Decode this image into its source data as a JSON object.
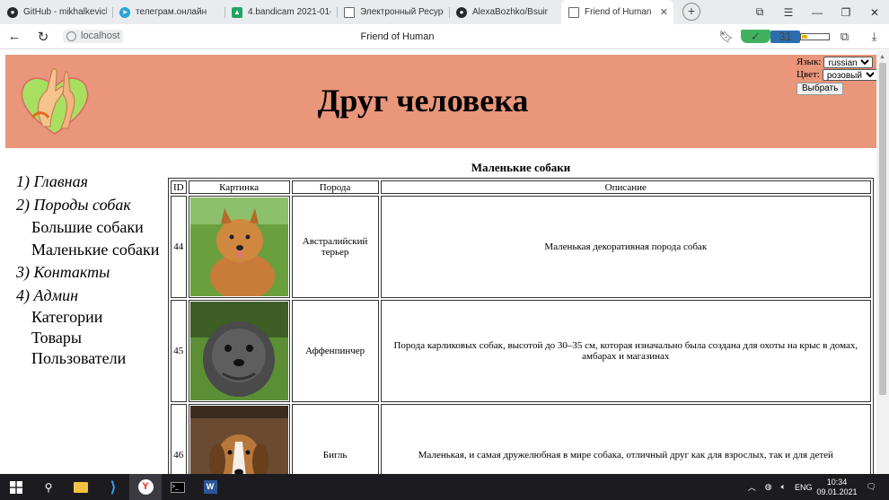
{
  "browser": {
    "tabs": [
      {
        "title": "GitHub - mikhalkevich",
        "icon": "github-icon",
        "color": "#24292e"
      },
      {
        "title": "телеграм.онлайн",
        "icon": "telegram-icon",
        "color": "#2aa3d8"
      },
      {
        "title": "4.bandicam 2021-01-0",
        "icon": "google-drive-icon",
        "color": "#1fa463"
      },
      {
        "title": "Электронный Ресурс",
        "icon": "document-icon",
        "color": "#666666"
      },
      {
        "title": "AlexaBozhko/Bsuir",
        "icon": "github-icon",
        "color": "#24292e"
      },
      {
        "title": "Friend of Human",
        "icon": "document-icon",
        "color": "#666666",
        "active": true
      }
    ],
    "url": "localhost",
    "page_title": "Friend of Human"
  },
  "site": {
    "title": "Друг человека",
    "header_color": "#e9967a",
    "settings": {
      "lang_label": "Язык:",
      "lang_value": "russian",
      "color_label": "Цвет:",
      "color_value": "розовый",
      "submit_label": "Выбрать"
    }
  },
  "nav": {
    "home": "1) Главная",
    "breeds": "2) Породы собак",
    "big_dogs": "Большие собаки",
    "small_dogs": "Маленькие собаки",
    "contacts": "3) Контакты",
    "admin": "4) Админ",
    "categories": "Категории",
    "goods": "Товары",
    "users": "Пользователи"
  },
  "content": {
    "heading": "Маленькие собаки",
    "columns": [
      "ID",
      "Картинка",
      "Порода",
      "Описание"
    ],
    "rows": [
      {
        "id": "44",
        "breed": "Австралийский терьер",
        "description": "Маленькая декоративная порода собак",
        "image": "australian-terrier-photo"
      },
      {
        "id": "45",
        "breed": "Аффенпинчер",
        "description": "Порода карликовых собак, высотой до 30–35 см, которая изначально была создана для охоты на крыс в домах, амбарах и магазинах",
        "image": "affenpinscher-photo"
      },
      {
        "id": "46",
        "breed": "Бигль",
        "description": "Маленькая, и самая дружелюбная в мире собака, отличный друг как для взрослых, так и для детей",
        "image": "beagle-photo"
      }
    ]
  },
  "taskbar": {
    "lang": "ENG",
    "time": "10:34",
    "date": "09.01.2021"
  }
}
